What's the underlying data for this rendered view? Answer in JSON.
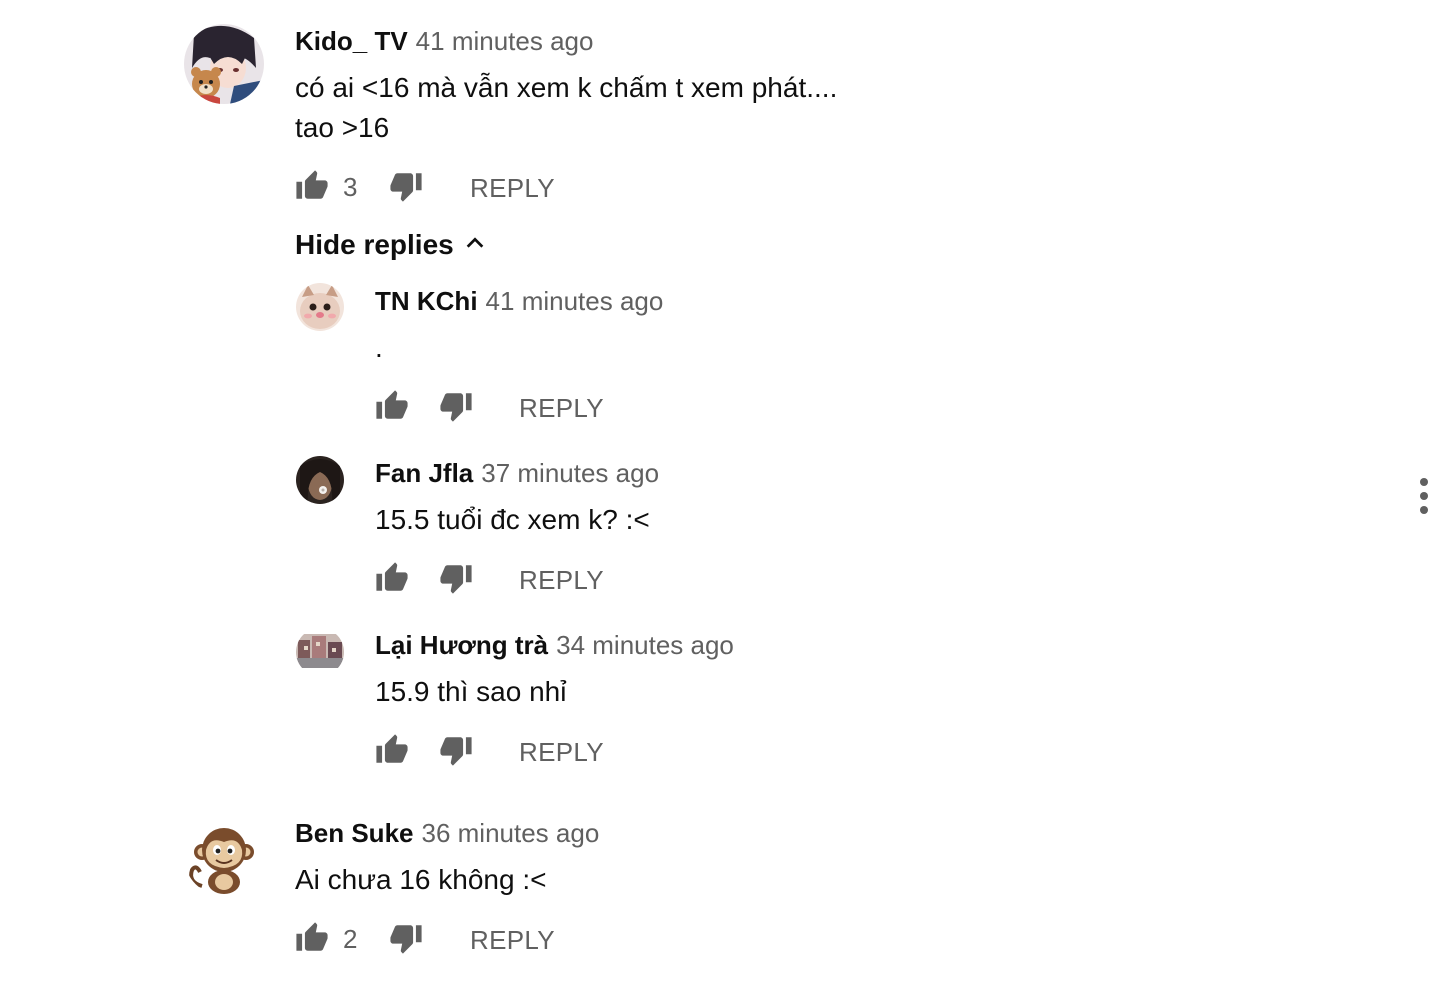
{
  "comments": [
    {
      "author": "Kido_ TV",
      "time": "41 minutes ago",
      "lines": [
        "có ai <16 mà vẫn xem k chấm t xem phát....",
        "tao >16"
      ],
      "likes": "3",
      "reply_label": "REPLY",
      "avatar_icon": "anime-avatar-icon"
    },
    {
      "author": "Ben Suke",
      "time": "36 minutes ago",
      "lines": [
        "Ai chưa 16 không :<"
      ],
      "likes": "2",
      "reply_label": "REPLY",
      "avatar_icon": "monkey-avatar-icon"
    }
  ],
  "hide_replies_label": "Hide replies",
  "replies": [
    {
      "author": "TN KChi",
      "time": "41 minutes ago",
      "text": ".",
      "reply_label": "REPLY",
      "avatar_icon": "cat-avatar-icon"
    },
    {
      "author": "Fan Jfla",
      "time": "37 minutes ago",
      "text": "15.5 tuổi đc xem k? :<",
      "reply_label": "REPLY",
      "avatar_icon": "photo-avatar-icon"
    },
    {
      "author": "Lại Hương trà",
      "time": "34 minutes ago",
      "text": "15.9 thì sao nhỉ",
      "reply_label": "REPLY",
      "avatar_icon": "street-photo-avatar-icon"
    }
  ],
  "colors": {
    "text_primary": "#0f0f0f",
    "text_secondary": "#606060",
    "background": "#ffffff"
  }
}
